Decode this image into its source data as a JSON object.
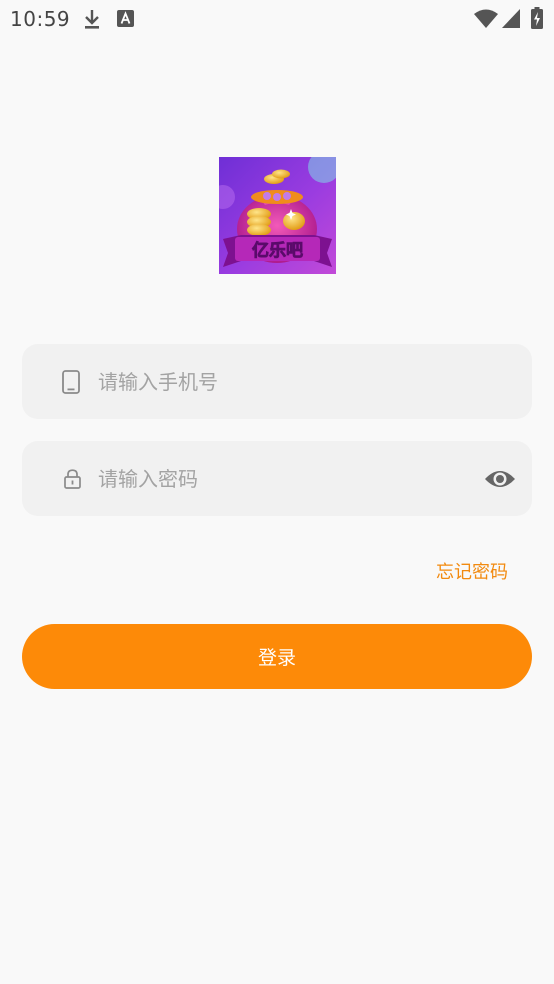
{
  "status_bar": {
    "time": "10:59",
    "left_icons": [
      "download-icon",
      "keyboard-a-icon"
    ],
    "right_icons": [
      "wifi-icon",
      "cellular-signal-icon",
      "battery-charging-icon"
    ]
  },
  "logo": {
    "text": "亿乐吧",
    "icon": "money-bag-coins-icon"
  },
  "form": {
    "phone": {
      "placeholder": "请输入手机号",
      "value": "",
      "icon": "phone-icon"
    },
    "password": {
      "placeholder": "请输入密码",
      "value": "",
      "icon": "lock-icon",
      "toggle_icon": "eye-icon"
    },
    "forgot_label": "忘记密码",
    "login_label": "登录"
  },
  "colors": {
    "background": "#f9f9f9",
    "field_background": "#f1f1f1",
    "accent": "#fd8a08",
    "link": "#f28a0f",
    "placeholder": "#a3a3a3"
  }
}
